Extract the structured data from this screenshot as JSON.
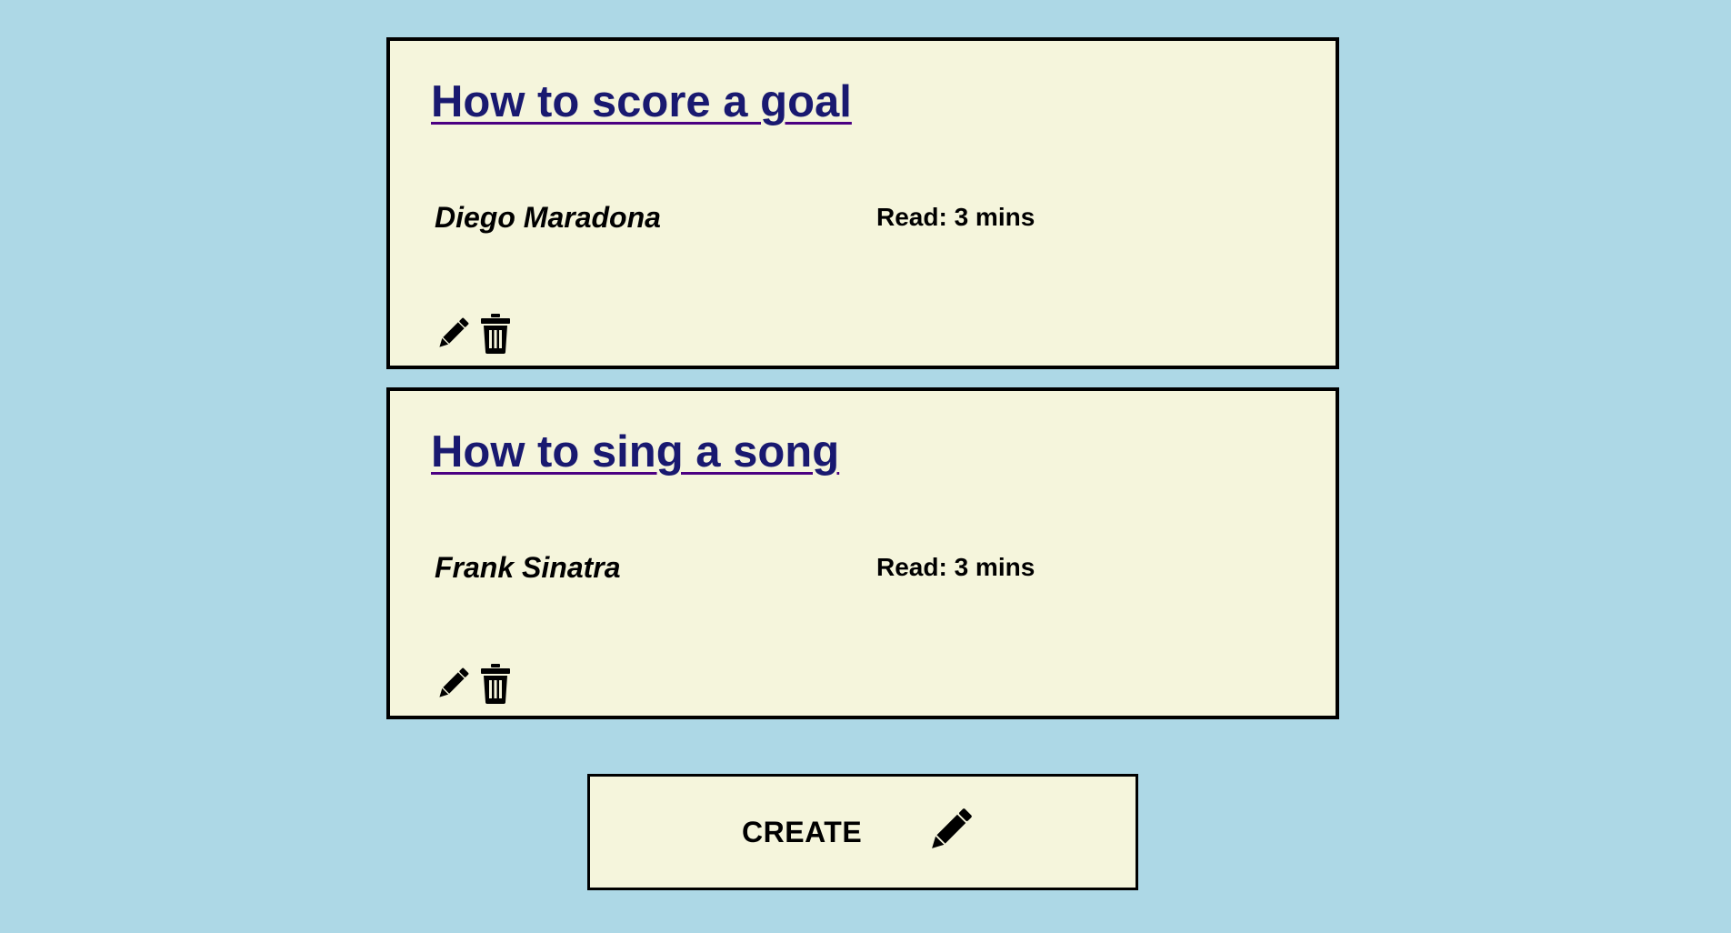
{
  "posts": [
    {
      "title": "How to score a goal",
      "author": "Diego Maradona",
      "read_time": "Read: 3 mins",
      "edit_icon": "pencil-icon",
      "delete_icon": "trash-icon"
    },
    {
      "title": "How to sing a song",
      "author": "Frank Sinatra",
      "read_time": "Read: 3 mins",
      "edit_icon": "pencil-icon",
      "delete_icon": "trash-icon"
    }
  ],
  "create_button": {
    "label": "CREATE",
    "icon": "pencil-icon"
  },
  "colors": {
    "background": "#add8e6",
    "card": "#f5f5dc",
    "title_link": "#191970",
    "text": "#000000"
  }
}
